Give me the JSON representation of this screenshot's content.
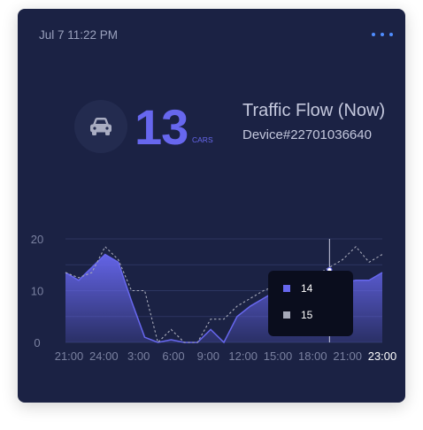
{
  "header": {
    "timestamp": "Jul 7 11:22 PM"
  },
  "widget": {
    "value": "13",
    "unit": "CARS",
    "title": "Traffic Flow (Now)",
    "device": "Device#22701036640"
  },
  "icons": {
    "menu": "more-horizontal-icon",
    "vehicle": "car-icon"
  },
  "colors": {
    "card": "#1b2244",
    "accent": "#6767ee",
    "menu": "#4f8dff",
    "series_secondary": "#a6a9b9"
  },
  "tooltip": {
    "rows": [
      {
        "value": "14",
        "color": "#6767ee"
      },
      {
        "value": "15",
        "color": "#a6a9b9"
      }
    ]
  },
  "chart_data": {
    "type": "area",
    "ylim": [
      0,
      20
    ],
    "y_ticks": [
      0,
      10,
      20
    ],
    "x_tick_labels": [
      "21:00",
      "24:00",
      "3:00",
      "6:00",
      "9:00",
      "12:00",
      "15:00",
      "18:00",
      "21:00",
      "23:00"
    ],
    "highlight_label": "23:00",
    "grid": true,
    "series": [
      {
        "style": "filled-area",
        "values": [
          13.5,
          12,
          14.5,
          17,
          15.5,
          8,
          1,
          0,
          0.5,
          0,
          0,
          2.5,
          0,
          5,
          7,
          8.5,
          10,
          12.5,
          12.5,
          11,
          14,
          11.5,
          12,
          12,
          13.5
        ]
      },
      {
        "style": "dotted-line",
        "values": [
          13.5,
          12.5,
          13.5,
          18.5,
          16,
          10,
          10,
          0,
          2.5,
          0,
          0,
          4.5,
          4.5,
          7,
          8.5,
          10,
          11,
          13.5,
          12,
          13,
          14.5,
          16,
          18.5,
          15.5,
          17
        ]
      }
    ],
    "cursor_index": 20
  }
}
